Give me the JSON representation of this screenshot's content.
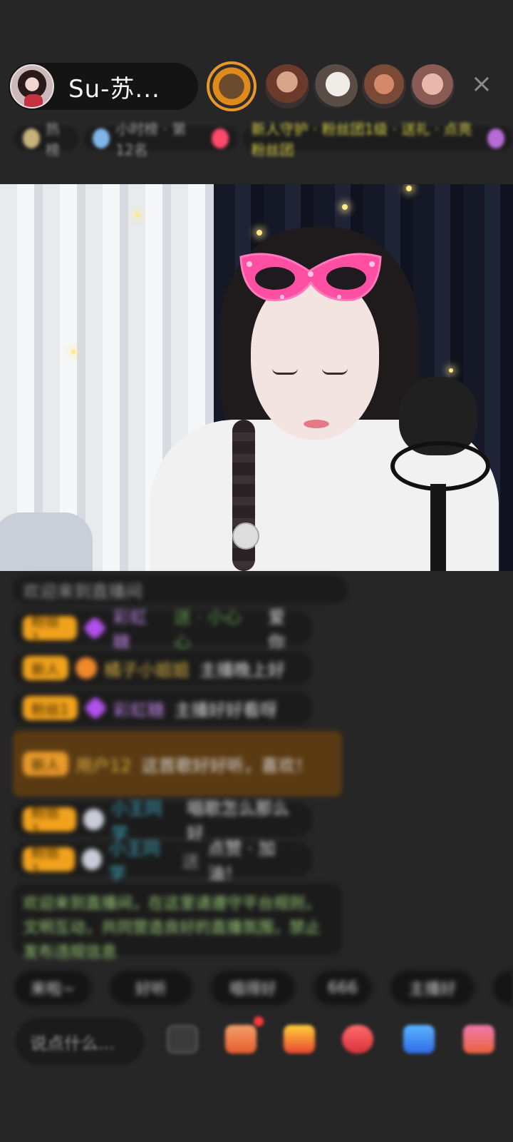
{
  "host": {
    "name": "Su-苏..."
  },
  "header": {
    "close_label": "×",
    "info_chips": [
      {
        "text": "热榜"
      },
      {
        "text": "小时榜 · 第12名"
      },
      {
        "text": "新人守护 · 粉丝团1级 · 送礼 · 点亮粉丝团"
      }
    ]
  },
  "chat": {
    "messages": [
      {
        "text": "欢迎来到直播间"
      },
      {
        "badge": "粉丝1",
        "user": "彩虹糖",
        "extra": "送 · 小心心",
        "text": "爱你"
      },
      {
        "badge": "新人",
        "user": "橘子小姐姐",
        "text": "主播晚上好"
      },
      {
        "badge": "粉丝1",
        "user": "彩虹糖",
        "text": "主播好好看呀"
      },
      {
        "badge": "新人",
        "user": "用户12",
        "text": "这首歌好好听，喜欢！"
      },
      {
        "badge": "粉丝1",
        "user": "小王同学",
        "text": "唱歌怎么那么好"
      },
      {
        "badge": "粉丝1",
        "user": "小王同学",
        "extra": "送",
        "text": "点赞 · 加油！"
      },
      {
        "text": "欢迎来到直播间，在这里请遵守平台规则，文明互动，共同营造良好的直播氛围，禁止发布违规信息"
      }
    ]
  },
  "quick_replies": [
    "来啦~",
    "好听",
    "唱得好",
    "666",
    "主播好"
  ],
  "bottom": {
    "say_placeholder": "说点什么..."
  }
}
